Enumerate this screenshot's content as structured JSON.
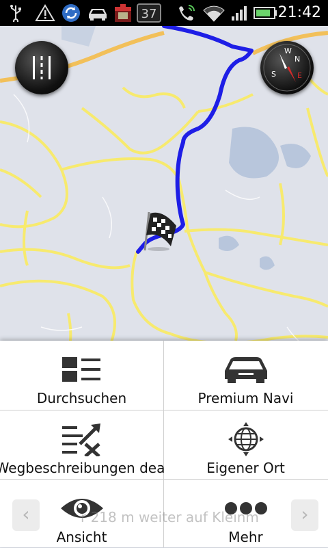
{
  "status_bar": {
    "time": "21:42",
    "notification_count": "37",
    "icons": [
      "usb-icon",
      "warning-icon",
      "sync-icon",
      "car-icon",
      "app-icon",
      "phone-icon",
      "wifi-icon",
      "signal-icon",
      "battery-icon"
    ]
  },
  "map": {
    "left_button_icon": "lanes-icon",
    "right_button_icon": "compass-icon",
    "compass_letters": [
      "W",
      "N",
      "S",
      "E"
    ],
    "route_color": "#1e1ee6",
    "road_color": "#f7ea6e"
  },
  "menu": {
    "items": [
      {
        "label": "Durchsuchen",
        "icon": "list-icon"
      },
      {
        "label": "Premium Navi",
        "icon": "car-icon"
      },
      {
        "label": "Wegbeschreibungen dea",
        "icon": "directions-icon"
      },
      {
        "label": "Eigener Ort",
        "icon": "location-icon"
      },
      {
        "label": "Ansicht",
        "icon": "eye-icon"
      },
      {
        "label": "Mehr",
        "icon": "more-icon"
      }
    ]
  },
  "background_hint": {
    "text": "r 218 m weiter auf Kleinm",
    "prev_icon": "chevron-left-icon",
    "next_icon": "chevron-right-icon"
  }
}
